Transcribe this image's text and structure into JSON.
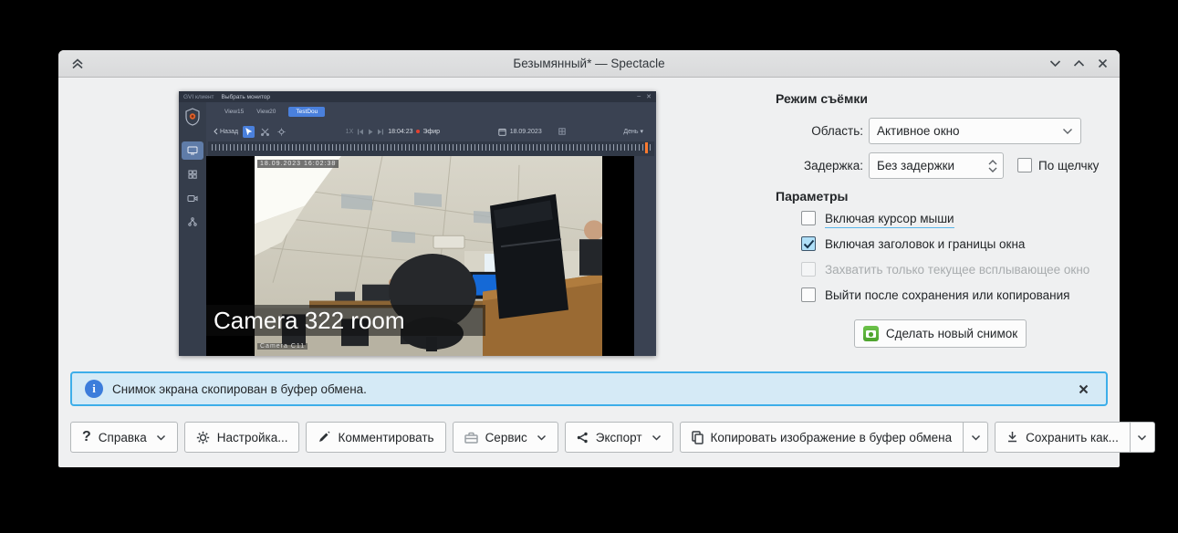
{
  "window": {
    "title": "Безымянный* — Spectacle"
  },
  "preview": {
    "app_name": "GVI клиент",
    "window_title": "Выбрать монитор",
    "tabs": [
      {
        "label": "View15",
        "active": false
      },
      {
        "label": "View20",
        "active": false
      },
      {
        "label": "TestDou",
        "active": true
      }
    ],
    "back_label": "Назад",
    "speed": "1X",
    "time": "18:04:23",
    "live_label": "Эфир",
    "date": "18.09.2023",
    "period": "День",
    "osd_timestamp": "18.09.2023 16:02:38",
    "camera_label": "Camera 322 room",
    "camera_osd": "Camera C11"
  },
  "panel": {
    "capture_mode_title": "Режим съёмки",
    "area_label": "Область:",
    "area_value": "Активное окно",
    "delay_label": "Задержка:",
    "delay_value": "Без задержки",
    "on_click_label": "По щелчку",
    "on_click_checked": false,
    "options_title": "Параметры",
    "options": [
      {
        "label": "Включая курсор мыши",
        "checked": false,
        "disabled": false,
        "underlined": true
      },
      {
        "label": "Включая заголовок и границы окна",
        "checked": true,
        "disabled": false,
        "underlined": false
      },
      {
        "label": "Захватить только текущее всплывающее окно",
        "checked": false,
        "disabled": true,
        "underlined": false
      },
      {
        "label": "Выйти после сохранения или копирования",
        "checked": false,
        "disabled": false,
        "underlined": false
      }
    ],
    "take_new_label": "Сделать новый снимок"
  },
  "message": {
    "text": "Снимок экрана скопирован в буфер обмена."
  },
  "toolbar": {
    "help": "Справка",
    "configure": "Настройка...",
    "annotate": "Комментировать",
    "tools": "Сервис",
    "export": "Экспорт",
    "copy": "Копировать изображение в буфер обмена",
    "save_as": "Сохранить как..."
  },
  "colors": {
    "accent": "#3daee9",
    "info_background": "#d5eaf6",
    "window_background": "#eff0f1",
    "preview_chrome": "#3a4252",
    "active_tab": "#4a80dc",
    "spectacle_green": "#5cb23d",
    "live_dot_red": "#e6402e",
    "timeline_marker_orange": "#ff7a2f"
  }
}
